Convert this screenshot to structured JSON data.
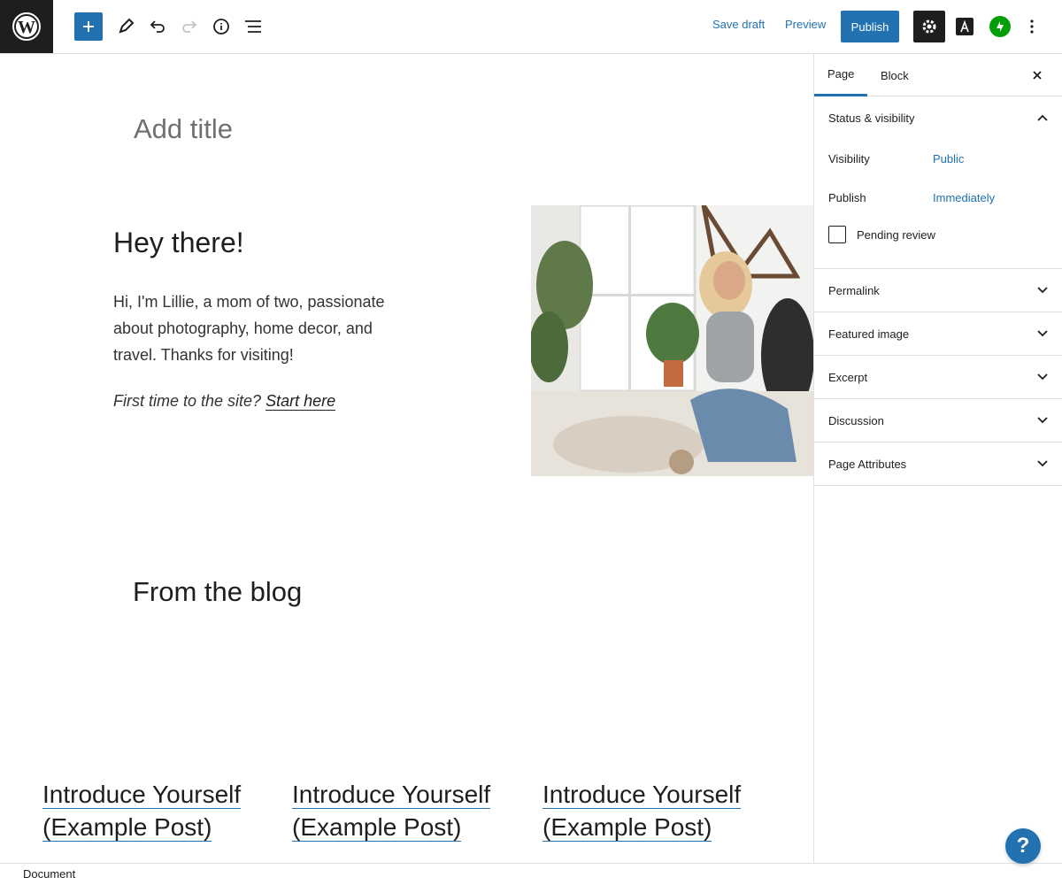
{
  "toolbar": {
    "logo_icon": "wordpress-logo-icon",
    "add_icon": "plus-icon",
    "tools_icon": "pencil-icon",
    "undo_icon": "undo-icon",
    "redo_icon": "redo-icon",
    "info_icon": "info-icon",
    "list_view_icon": "list-view-icon",
    "save_draft_label": "Save draft",
    "preview_label": "Preview",
    "publish_label": "Publish",
    "settings_icon": "gear-icon",
    "font_icon": "typography-icon",
    "jetpack_icon": "jetpack-icon",
    "more_icon": "vertical-ellipsis-icon",
    "accent_color": "#2271b1"
  },
  "editor": {
    "title_placeholder": "Add title",
    "heading": "Hey there!",
    "intro": "Hi, I'm Lillie, a mom of two, passionate about photography, home decor, and travel. Thanks for visiting!",
    "cta_prefix": "First time to the site?",
    "cta_link": "Start here",
    "hero_image": "photo of woman sitting on bed with plants",
    "blog_heading": "From the blog",
    "posts": [
      {
        "title": "Introduce Yourself (Example Post)"
      },
      {
        "title": "Introduce Yourself (Example Post)"
      },
      {
        "title": "Introduce Yourself (Example Post)"
      }
    ]
  },
  "sidebar": {
    "tabs": [
      {
        "label": "Page"
      },
      {
        "label": "Block"
      }
    ],
    "close_icon": "close-icon",
    "status_panel": {
      "title": "Status & visibility",
      "visibility_label": "Visibility",
      "visibility_value": "Public",
      "publish_label": "Publish",
      "publish_value": "Immediately",
      "pending_label": "Pending review"
    },
    "panels": [
      {
        "title": "Permalink"
      },
      {
        "title": "Featured image"
      },
      {
        "title": "Excerpt"
      },
      {
        "title": "Discussion"
      },
      {
        "title": "Page Attributes"
      }
    ]
  },
  "footer": {
    "breadcrumb": "Document",
    "help_label": "?"
  }
}
